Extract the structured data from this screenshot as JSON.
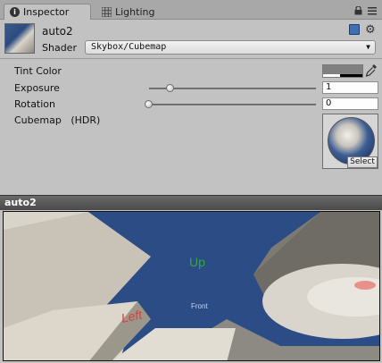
{
  "tabs": {
    "inspector": "Inspector",
    "lighting": "Lighting"
  },
  "material": {
    "name": "auto2",
    "shader_label": "Shader",
    "shader_value": "Skybox/Cubemap"
  },
  "properties": {
    "tint_label": "Tint Color",
    "tint_color": "#808080",
    "exposure_label": "Exposure",
    "exposure_value": "1",
    "exposure_fraction": 0.13,
    "rotation_label": "Rotation",
    "rotation_value": "0",
    "rotation_fraction": 0.0,
    "cubemap_label": "Cubemap",
    "cubemap_hdr": "(HDR)",
    "select_label": "Select"
  },
  "preview": {
    "title": "auto2",
    "label_up": "Up",
    "label_left": "Left",
    "label_front": "Front"
  },
  "icons": {
    "info": "info-icon",
    "lighting": "grid-icon",
    "lock": "lock-icon",
    "menu": "menu-icon",
    "book": "book-icon",
    "gear": "gear-icon",
    "picker": "eyedropper-icon"
  },
  "colors": {
    "sky_blue": "#2c4c85",
    "up_text": "#2faa3a",
    "left_text": "#e03a3a"
  }
}
